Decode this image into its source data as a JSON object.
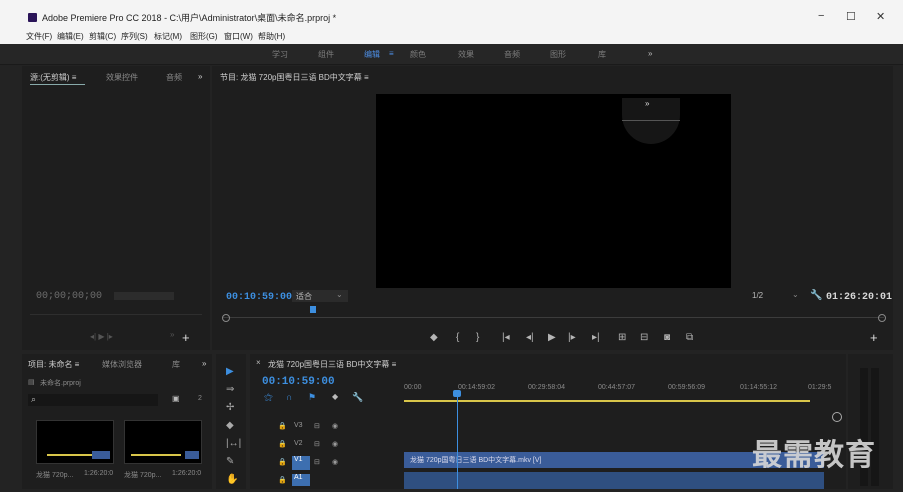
{
  "window": {
    "title": "Adobe Premiere Pro CC 2018 - C:\\用户\\Administrator\\桌面\\未命名.prproj *",
    "minimize": "−",
    "maximize": "☐",
    "close": "✕"
  },
  "menu": [
    "文件(F)",
    "编辑(E)",
    "剪辑(C)",
    "序列(S)",
    "标记(M)",
    "图形(G)",
    "窗口(W)",
    "帮助(H)"
  ],
  "workspaces": {
    "items": [
      "学习",
      "组件",
      "编辑",
      "颜色",
      "效果",
      "音频",
      "图形",
      "库"
    ],
    "active_menu_glyph": "≡",
    "more": "»"
  },
  "source_panel": {
    "tabs": [
      "源:(无剪辑) ≡",
      "效果控件",
      "音频"
    ],
    "more": "»",
    "timecode": "00;00;00;00"
  },
  "program_monitor": {
    "tab": "节目: 龙猫 720p国粤日三语 BD中文字幕 ≡",
    "timecode": "00:10:59:00",
    "fit": "适合",
    "resolution": "1/2",
    "duration": "01:26:20:01",
    "overlay_glyph": "»",
    "controls": [
      "◆",
      "{",
      "}",
      "|◂",
      "◂|",
      "▶",
      "|▸",
      "▸|",
      "⊞",
      "⊟",
      "◙",
      "⧉"
    ],
    "add": "+"
  },
  "project_panel": {
    "tabs": [
      "项目: 未命名 ≡",
      "媒体浏览器",
      "库"
    ],
    "more": "»",
    "file": "未命名.prproj",
    "item_count": "2",
    "clips": [
      {
        "name": "龙猫 720p...",
        "duration": "1:26:20:0"
      },
      {
        "name": "龙猫 720p...",
        "duration": "1:26:20:0"
      }
    ]
  },
  "timeline": {
    "tab": "龙猫 720p国粤日三语 BD中文字幕 ≡",
    "close": "×",
    "timecode": "00:10:59:00",
    "ruler": [
      "00:00",
      "00:14:59:02",
      "00:29:58:04",
      "00:44:57:07",
      "00:59:56:09",
      "01:14:55:12",
      "01:29:5"
    ],
    "tracks": [
      "V3",
      "V2",
      "V1",
      "A1"
    ],
    "clip_label": "龙猫 720p国粤日三语 BD中文字幕.mkv [V]",
    "playhead_fraction": 0.127
  },
  "watermark": "最需教育",
  "colors": {
    "accent_blue": "#3d8fe0",
    "clip_blue": "#3a5c99",
    "work_area_yellow": "#d9c64a"
  }
}
